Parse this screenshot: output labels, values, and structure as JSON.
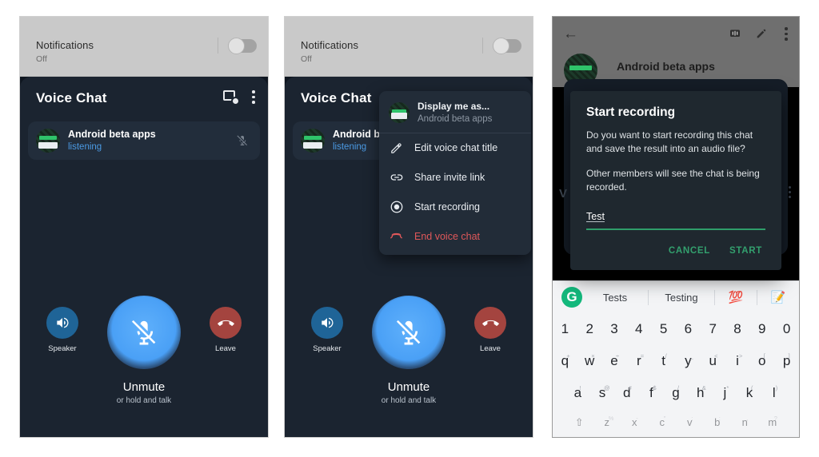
{
  "panel1": {
    "notifications": {
      "title": "Notifications",
      "subtitle": "Off",
      "toggle_state": "off"
    },
    "voice_chat": {
      "title": "Voice Chat",
      "cast_icon": "cast-icon",
      "overflow_icon": "overflow-menu-icon",
      "participant": {
        "name": "Android beta apps",
        "status": "listening",
        "mic_icon": "mic-off-icon"
      },
      "controls": {
        "speaker_label": "Speaker",
        "speaker_icon": "speaker-icon",
        "leave_label": "Leave",
        "leave_icon": "end-call-icon",
        "mute_icon": "mic-off-icon",
        "mute_label": "Unmute",
        "mute_hint": "or hold and talk"
      }
    }
  },
  "panel2": {
    "notifications": {
      "title": "Notifications",
      "subtitle": "Off",
      "toggle_state": "off"
    },
    "voice_chat": {
      "title": "Voice Chat",
      "participant": {
        "name": "Android bet",
        "status": "listening"
      },
      "controls": {
        "speaker_label": "Speaker",
        "leave_label": "Leave",
        "mute_label": "Unmute",
        "mute_hint": "or hold and talk"
      }
    },
    "menu": {
      "header": {
        "title": "Display me as...",
        "subtitle": "Android beta apps",
        "avatar": "group-avatar"
      },
      "items": [
        {
          "label": "Edit voice chat title",
          "icon": "pencil-icon",
          "danger": false
        },
        {
          "label": "Share invite link",
          "icon": "link-icon",
          "danger": false
        },
        {
          "label": "Start recording",
          "icon": "record-icon",
          "danger": false
        },
        {
          "label": "End voice chat",
          "icon": "end-call-icon",
          "danger": true
        }
      ]
    }
  },
  "panel3": {
    "appbar": {
      "back_icon": "back-arrow-icon",
      "voicechat_icon": "voice-chat-icon",
      "edit_icon": "pencil-icon",
      "overflow_icon": "overflow-menu-icon"
    },
    "chat_name": "Android beta apps",
    "ghost_voice_chat": "V",
    "dialog": {
      "title": "Start recording",
      "body1": "Do you want to start recording this chat and save the result into an audio file?",
      "body2": "Other members will see the chat is being recorded.",
      "input_value": "Test",
      "cancel_label": "CANCEL",
      "confirm_label": "START",
      "accent_color": "#33a06e"
    },
    "keyboard": {
      "logo": "G",
      "suggestions": [
        "Tests",
        "Testing"
      ],
      "emoji": [
        "💯",
        "📝"
      ],
      "row_numbers": [
        "1",
        "2",
        "3",
        "4",
        "5",
        "6",
        "7",
        "8",
        "9",
        "0"
      ],
      "row_top": [
        {
          "k": "q",
          "s": "+"
        },
        {
          "k": "w",
          "s": "×"
        },
        {
          "k": "e",
          "s": "÷"
        },
        {
          "k": "r",
          "s": "="
        },
        {
          "k": "t",
          "s": "/"
        },
        {
          "k": "y",
          "s": "_"
        },
        {
          "k": "u",
          "s": "<"
        },
        {
          "k": "i",
          "s": ">"
        },
        {
          "k": "o",
          "s": "["
        },
        {
          "k": "p",
          "s": "]"
        }
      ],
      "row_home": [
        {
          "k": "a",
          "s": "!"
        },
        {
          "k": "s",
          "s": "@"
        },
        {
          "k": "d",
          "s": "#"
        },
        {
          "k": "f",
          "s": "$"
        },
        {
          "k": "g",
          "s": "/"
        },
        {
          "k": "h",
          "s": "&"
        },
        {
          "k": "j",
          "s": "*"
        },
        {
          "k": "k",
          "s": "("
        },
        {
          "k": "l",
          "s": ")"
        }
      ],
      "row_bottom": [
        {
          "k": "⇧",
          "s": ""
        },
        {
          "k": "z",
          "s": "%"
        },
        {
          "k": "x",
          "s": "-"
        },
        {
          "k": "c",
          "s": "\""
        },
        {
          "k": "v",
          "s": ":"
        },
        {
          "k": "b",
          "s": ";"
        },
        {
          "k": "n",
          "s": ","
        },
        {
          "k": "m",
          "s": "?"
        }
      ]
    }
  },
  "colors": {
    "sheet_bg": "#1b2430",
    "mute_blue": "#4aa0f6",
    "speaker_blue": "#1f6497",
    "leave_red": "#a4443f",
    "status_blue": "#4b9ae4",
    "danger_red": "#e0585a",
    "accent_green": "#33a06e"
  }
}
